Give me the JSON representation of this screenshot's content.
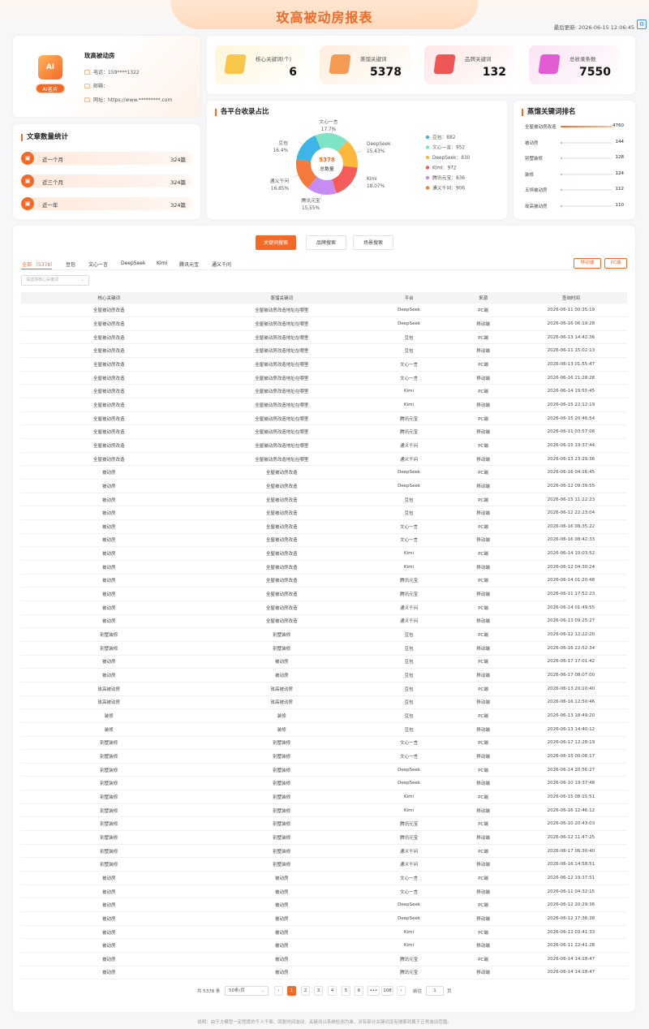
{
  "header": {
    "title": "玫高被动房报表",
    "updated": "最后更新: 2026-06-15 12:06:45"
  },
  "profile": {
    "logo_text": "AI",
    "badge": "AI名片",
    "name": "玫高被动房",
    "phone": "电话：159****1322",
    "email": "邮箱：",
    "website": "网址：https://www.*********.com"
  },
  "stats": [
    {
      "label": "核心关键词(个)",
      "value": "6",
      "color": "#fff5d9",
      "icon": "#f7c64a"
    },
    {
      "label": "蒸馏关键词",
      "value": "5378",
      "color": "#ffeede",
      "icon": "#f49a54"
    },
    {
      "label": "品牌关键词",
      "value": "132",
      "color": "#ffe6e6",
      "icon": "#ee5656"
    },
    {
      "label": "总收录条数",
      "value": "7550",
      "color": "#fbe3f4",
      "icon": "#e25bd2"
    }
  ],
  "article_stats": {
    "title": "文章数量统计",
    "rows": [
      {
        "label": "近一个月",
        "value": "324篇"
      },
      {
        "label": "近三个月",
        "value": "324篇"
      },
      {
        "label": "近一年",
        "value": "324篇"
      }
    ]
  },
  "chart_data": {
    "type": "pie",
    "title": "各平台收录占比",
    "center_value": "5378",
    "center_label": "总数量",
    "slices": [
      {
        "name": "豆包",
        "value": 882,
        "percent": "16.4%",
        "color": "#3db5e6"
      },
      {
        "name": "文心一言",
        "value": 952,
        "percent": "17.7%",
        "color": "#7fe3c6"
      },
      {
        "name": "DeepSeek",
        "value": 830,
        "percent": "15.43%",
        "color": "#fbb83c"
      },
      {
        "name": "Kimi",
        "value": 972,
        "percent": "18.07%",
        "color": "#f45c5c"
      },
      {
        "name": "腾讯元宝",
        "value": 836,
        "percent": "15.55%",
        "color": "#c78cf2"
      },
      {
        "name": "通义千问",
        "value": 906,
        "percent": "16.85%",
        "color": "#f6793c"
      }
    ],
    "legend": [
      "豆包：882",
      "文心一言：952",
      "DeepSeek：830",
      "Kimi：972",
      "腾讯元宝：836",
      "通义千问：906"
    ],
    "legend_position": "right"
  },
  "ranking": {
    "title": "蒸馏关键词排名",
    "items": [
      {
        "name": "全屋被动房改造",
        "value": 4760
      },
      {
        "name": "被动房",
        "value": 144
      },
      {
        "name": "别墅装修",
        "value": 128
      },
      {
        "name": "装修",
        "value": 124
      },
      {
        "name": "五恒被动房",
        "value": 112
      },
      {
        "name": "玫高被动房",
        "value": 110
      }
    ]
  },
  "search_tabs": [
    "关键词搜索",
    "品牌搜索",
    "场景搜索"
  ],
  "platform_tabs": [
    "全部 （5378）",
    "豆包",
    "文心一言",
    "DeepSeek",
    "Kimi",
    "腾讯元宝",
    "通义千问"
  ],
  "device_buttons": [
    "移动端",
    "PC端"
  ],
  "filter_placeholder": "请选择核心关键词",
  "table": {
    "headers": [
      "核心关键词",
      "蒸馏关键词",
      "平台",
      "来源",
      "查询时间"
    ],
    "rows": [
      [
        "全屋被动房改造",
        "全屋被动房改造地址在哪里",
        "DeepSeek",
        "PC端",
        "2026-06-11 00:35:19"
      ],
      [
        "全屋被动房改造",
        "全屋被动房改造地址在哪里",
        "DeepSeek",
        "移动端",
        "2026-06-16 06:19:28"
      ],
      [
        "全屋被动房改造",
        "全屋被动房改造地址在哪里",
        "豆包",
        "PC端",
        "2026-06-13 14:42:36"
      ],
      [
        "全屋被动房改造",
        "全屋被动房改造地址在哪里",
        "豆包",
        "移动端",
        "2026-06-11 15:02:13"
      ],
      [
        "全屋被动房改造",
        "全屋被动房改造地址在哪里",
        "文心一言",
        "PC端",
        "2026-06-13 01:55:47"
      ],
      [
        "全屋被动房改造",
        "全屋被动房改造地址在哪里",
        "文心一言",
        "移动端",
        "2026-06-16 21:28:28"
      ],
      [
        "全屋被动房改造",
        "全屋被动房改造地址在哪里",
        "Kimi",
        "PC端",
        "2026-06-14 19:55:45"
      ],
      [
        "全屋被动房改造",
        "全屋被动房改造地址在哪里",
        "Kimi",
        "移动端",
        "2026-06-15 22:12:19"
      ],
      [
        "全屋被动房改造",
        "全屋被动房改造地址在哪里",
        "腾讯元宝",
        "PC端",
        "2026-06-15 20:46:54"
      ],
      [
        "全屋被动房改造",
        "全屋被动房改造地址在哪里",
        "腾讯元宝",
        "移动端",
        "2026-06-11 03:57:08"
      ],
      [
        "全屋被动房改造",
        "全屋被动房改造地址在哪里",
        "通义千问",
        "PC端",
        "2026-06-15 19:37:44"
      ],
      [
        "全屋被动房改造",
        "全屋被动房改造地址在哪里",
        "通义千问",
        "移动端",
        "2026-06-13 23:29:36"
      ],
      [
        "被动房",
        "全屋被动房改造",
        "DeepSeek",
        "PC端",
        "2026-06-16 04:16:45"
      ],
      [
        "被动房",
        "全屋被动房改造",
        "DeepSeek",
        "移动端",
        "2026-06-12 09:39:55"
      ],
      [
        "被动房",
        "全屋被动房改造",
        "豆包",
        "PC端",
        "2026-06-15 11:22:23"
      ],
      [
        "被动房",
        "全屋被动房改造",
        "豆包",
        "移动端",
        "2026-06-12 22:23:04"
      ],
      [
        "被动房",
        "全屋被动房改造",
        "文心一言",
        "PC端",
        "2026-06-16 08:35:22"
      ],
      [
        "被动房",
        "全屋被动房改造",
        "文心一言",
        "移动端",
        "2026-06-16 08:42:33"
      ],
      [
        "被动房",
        "全屋被动房改造",
        "Kimi",
        "PC端",
        "2026-06-14 10:03:52"
      ],
      [
        "被动房",
        "全屋被动房改造",
        "Kimi",
        "移动端",
        "2026-06-12 04:30:24"
      ],
      [
        "被动房",
        "全屋被动房改造",
        "腾讯元宝",
        "PC端",
        "2026-06-14 01:20:48"
      ],
      [
        "被动房",
        "全屋被动房改造",
        "腾讯元宝",
        "移动端",
        "2026-06-11 17:52:23"
      ],
      [
        "被动房",
        "全屋被动房改造",
        "通义千问",
        "PC端",
        "2026-06-14 01:49:55"
      ],
      [
        "被动房",
        "全屋被动房改造",
        "通义千问",
        "移动端",
        "2026-06-13 09:25:27"
      ],
      [
        "别墅装修",
        "别墅装修",
        "豆包",
        "PC端",
        "2026-06-12 12:22:20"
      ],
      [
        "别墅装修",
        "别墅装修",
        "豆包",
        "移动端",
        "2026-06-16 22:52:34"
      ],
      [
        "被动房",
        "被动房",
        "豆包",
        "PC端",
        "2026-06-17 17:01:42"
      ],
      [
        "被动房",
        "被动房",
        "豆包",
        "移动端",
        "2026-06-17 08:07:00"
      ],
      [
        "玫高被动房",
        "玫高被动房",
        "豆包",
        "PC端",
        "2026-06-13 20:10:40"
      ],
      [
        "玫高被动房",
        "玫高被动房",
        "豆包",
        "移动端",
        "2026-06-16 12:50:46"
      ],
      [
        "装修",
        "装修",
        "豆包",
        "PC端",
        "2026-06-13 18:49:20"
      ],
      [
        "装修",
        "装修",
        "豆包",
        "移动端",
        "2026-06-13 14:40:12"
      ],
      [
        "别墅装修",
        "别墅装修",
        "文心一言",
        "PC端",
        "2026-06-17 12:28:19"
      ],
      [
        "别墅装修",
        "别墅装修",
        "文心一言",
        "移动端",
        "2026-06-15 00:06:17"
      ],
      [
        "别墅装修",
        "别墅装修",
        "DeepSeek",
        "PC端",
        "2026-06-14 20:56:27"
      ],
      [
        "别墅装修",
        "别墅装修",
        "DeepSeek",
        "移动端",
        "2026-06-10 19:37:48"
      ],
      [
        "别墅装修",
        "别墅装修",
        "Kimi",
        "PC端",
        "2026-06-15 08:15:51"
      ],
      [
        "别墅装修",
        "别墅装修",
        "Kimi",
        "移动端",
        "2026-06-16 12:46:12"
      ],
      [
        "别墅装修",
        "别墅装修",
        "腾讯元宝",
        "PC端",
        "2026-06-10 20:43:03"
      ],
      [
        "别墅装修",
        "别墅装修",
        "腾讯元宝",
        "移动端",
        "2026-06-12 11:47:25"
      ],
      [
        "别墅装修",
        "别墅装修",
        "通义千问",
        "PC端",
        "2026-06-17 06:30:40"
      ],
      [
        "别墅装修",
        "别墅装修",
        "通义千问",
        "移动端",
        "2026-06-16 14:58:51"
      ],
      [
        "被动房",
        "被动房",
        "文心一言",
        "PC端",
        "2026-06-12 19:37:51"
      ],
      [
        "被动房",
        "被动房",
        "文心一言",
        "移动端",
        "2026-06-11 04:32:15"
      ],
      [
        "被动房",
        "被动房",
        "DeepSeek",
        "PC端",
        "2026-06-12 20:29:36"
      ],
      [
        "被动房",
        "被动房",
        "DeepSeek",
        "移动端",
        "2026-06-12 17:36:38"
      ],
      [
        "被动房",
        "被动房",
        "Kimi",
        "PC端",
        "2026-06-12 03:41:33"
      ],
      [
        "被动房",
        "被动房",
        "Kimi",
        "移动端",
        "2026-06-11 22:41:28"
      ],
      [
        "被动房",
        "被动房",
        "腾讯元宝",
        "PC端",
        "2026-06-14 14:18:47"
      ],
      [
        "被动房",
        "被动房",
        "腾讯元宝",
        "移动端",
        "2026-06-14 14:18:47"
      ]
    ]
  },
  "pagination": {
    "total": "共 5378 条",
    "page_size": "50条/页",
    "prev": "‹",
    "next": "›",
    "pages": [
      "1",
      "2",
      "3",
      "4",
      "5",
      "6",
      "•••",
      "108"
    ],
    "current": "1",
    "goto_label": "前往",
    "goto_value": "1",
    "goto_suffix": "页"
  },
  "footer_note": "说明：由于大模型一定程度的千人千面、回复时间波动、关键词以系统检测为准，对有部分关键词没有搜索到属于正常波动范围。"
}
